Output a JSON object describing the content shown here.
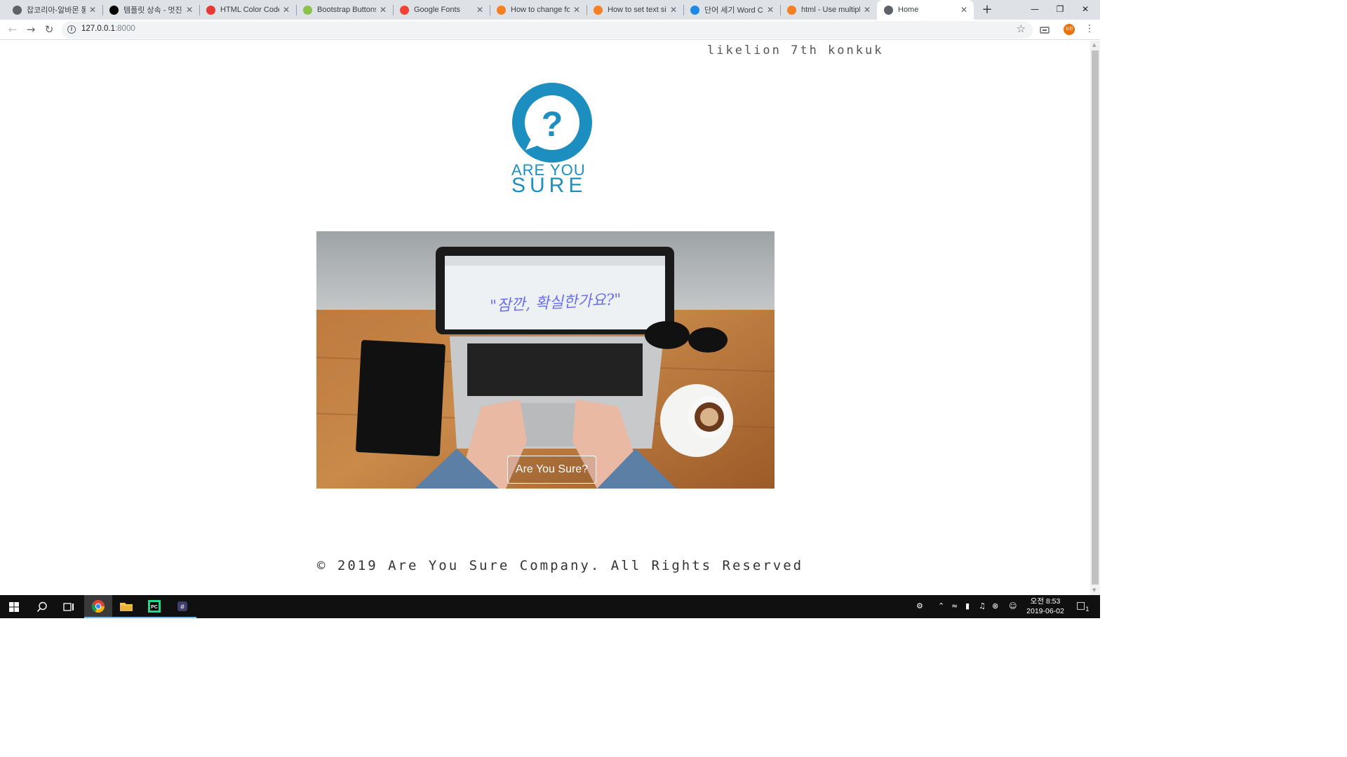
{
  "browser": {
    "tabs": [
      {
        "title": "잡코리아-알바몬 통",
        "icon_color": "#5f6368",
        "icon": "globe-icon"
      },
      {
        "title": "템플릿 상속 - 멋진",
        "icon_color": "#000000",
        "icon": "circle-icon"
      },
      {
        "title": "HTML Color Codes",
        "icon_color": "#e53935",
        "icon": "color-wheel-icon"
      },
      {
        "title": "Bootstrap Buttons",
        "icon_color": "#8bc34a",
        "icon": "w3-icon"
      },
      {
        "title": "Google Fonts",
        "icon_color": "#f44336",
        "icon": "google-fonts-icon"
      },
      {
        "title": "How to change for",
        "icon_color": "#f48024",
        "icon": "stackoverflow-icon"
      },
      {
        "title": "How to set text siz",
        "icon_color": "#f48024",
        "icon": "stackoverflow-icon"
      },
      {
        "title": "단어 세기 Word Co",
        "icon_color": "#1e88e5",
        "icon": "wordcounter-icon"
      },
      {
        "title": "html - Use multipl",
        "icon_color": "#f48024",
        "icon": "stackoverflow-icon"
      },
      {
        "title": "Home",
        "icon_color": "#5f6368",
        "icon": "globe-icon"
      }
    ],
    "active_tab": 9,
    "url_host": "127.0.0.1",
    "url_port": ":8000",
    "profile_initials": "유환"
  },
  "page": {
    "brand": "likelion 7th konkuk",
    "logo_line1": "ARE YOU",
    "logo_line2": "SURE",
    "hero_quote": "\"잠깐, 확실한가요?\"",
    "hero_button": "Are You Sure?",
    "footer": "© 2019 Are You Sure Company. All Rights Reserved",
    "accent_color": "#1c8fc0"
  },
  "taskbar": {
    "clock_time": "오전 8:53",
    "clock_date": "2019-06-02",
    "notification_count": "1"
  }
}
